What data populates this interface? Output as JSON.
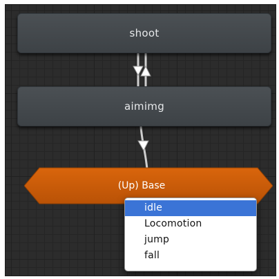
{
  "states": {
    "shoot": "shoot",
    "aimimg": "aimimg"
  },
  "layer_node": {
    "label": "(Up) Base"
  },
  "dropdown": {
    "items": [
      "idle",
      "Locomotion",
      "jump",
      "fall"
    ],
    "selected_index": 0
  },
  "colors": {
    "canvas_bg": "#2c2c2c",
    "state_node": "#464b4f",
    "layer_node": "#cc5c09",
    "transition": "#e0e0e0",
    "selection": "#3b74d6"
  }
}
